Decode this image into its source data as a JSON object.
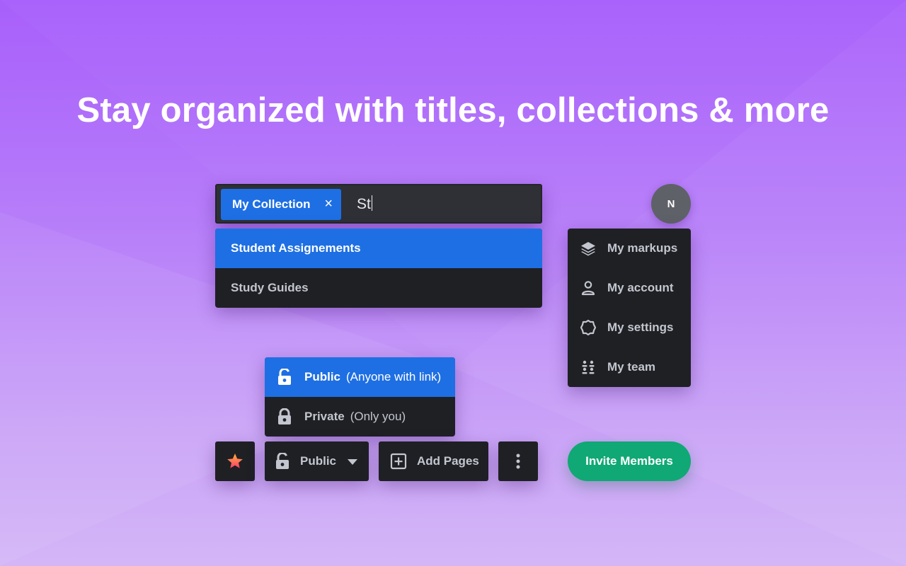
{
  "headline": "Stay organized with titles, collections & more",
  "search": {
    "chip_label": "My Collection",
    "chip_remove": "×",
    "query": "St"
  },
  "suggestions": [
    {
      "label": "Student Assignements",
      "highlighted": true
    },
    {
      "label": "Study Guides",
      "highlighted": false
    }
  ],
  "user": {
    "avatar_initial": "N",
    "menu": [
      {
        "label": "My markups",
        "icon": "layers-icon"
      },
      {
        "label": "My account",
        "icon": "user-icon"
      },
      {
        "label": "My settings",
        "icon": "gear-icon"
      },
      {
        "label": "My team",
        "icon": "team-icon"
      }
    ]
  },
  "privacy_menu": [
    {
      "label": "Public",
      "detail": "(Anyone with link)",
      "icon": "unlocked-icon",
      "highlighted": true
    },
    {
      "label": "Private",
      "detail": "(Only you)",
      "icon": "lock-icon",
      "highlighted": false
    }
  ],
  "toolbar": {
    "star_icon": "star-icon",
    "visibility_label": "Public",
    "add_pages_label": "Add Pages",
    "more_icon": "more-vertical-icon"
  },
  "invite_label": "Invite Members",
  "colors": {
    "accent_blue": "#1e6fe3",
    "panel_dark": "#1f2024",
    "invite_green": "#10a875",
    "star": "#ff6a3d"
  }
}
